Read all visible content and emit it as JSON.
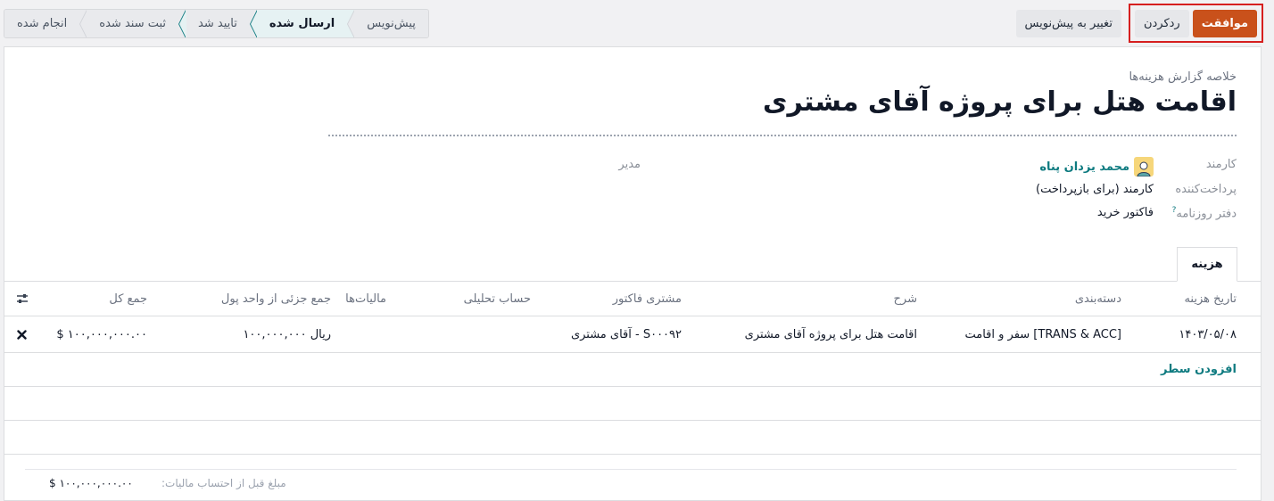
{
  "actions": {
    "approve_label": "موافقت",
    "refuse_label": "ردکردن",
    "reset_draft_label": "تغییر به پیش‌نویس"
  },
  "statusbar": {
    "stages": [
      "پیش‌نویس",
      "ارسال شده",
      "تایید شد",
      "ثبت سند شده",
      "انجام شده"
    ],
    "active": "ارسال شده"
  },
  "sheet": {
    "subtitle": "خلاصه گزارش هزینه‌ها",
    "title": "اقامت هتل برای پروژه آقای مشتری",
    "fields": {
      "employee_label": "کارمند",
      "employee_value": "محمد یزدان پناه",
      "manager_label": "مدیر",
      "paid_by_label": "پرداخت‌کننده",
      "paid_by_value": "کارمند (برای بازپرداخت)",
      "journal_label": "دفتر روزنامه",
      "journal_help": "?",
      "journal_value": "فاکتور خرید"
    },
    "tab_label": "هزینه"
  },
  "table": {
    "headers": {
      "date": "تاریخ هزینه",
      "category": "دسته‌بندی",
      "description": "شرح",
      "customer": "مشتری فاکتور",
      "analytic": "حساب تحلیلی",
      "taxes": "مالیات‌ها",
      "subtotal": "جمع جزئی از واحد پول",
      "total": "جمع کل"
    },
    "rows": [
      {
        "date": "۱۴۰۳/۰۵/۰۸",
        "category": "[TRANS & ACC] سفر و اقامت",
        "description": "اقامت هتل برای پروژه آقای مشتری",
        "customer": "S۰۰۰۹۲ - آقای مشتری",
        "analytic": "",
        "taxes": "",
        "subtotal": "ریال ۱۰۰,۰۰۰,۰۰۰",
        "total": "$ ۱۰۰,۰۰۰,۰۰۰.۰۰"
      }
    ],
    "add_line_label": "افزودن سطر"
  },
  "footer": {
    "untaxed_label": "مبلغ قبل از احتساب مالیات:",
    "untaxed_value": "$ ۱۰۰,۰۰۰,۰۰۰.۰۰"
  },
  "colors": {
    "primary": "#c9511b",
    "accent": "#0f7b80",
    "highlight": "#d61f1f"
  }
}
